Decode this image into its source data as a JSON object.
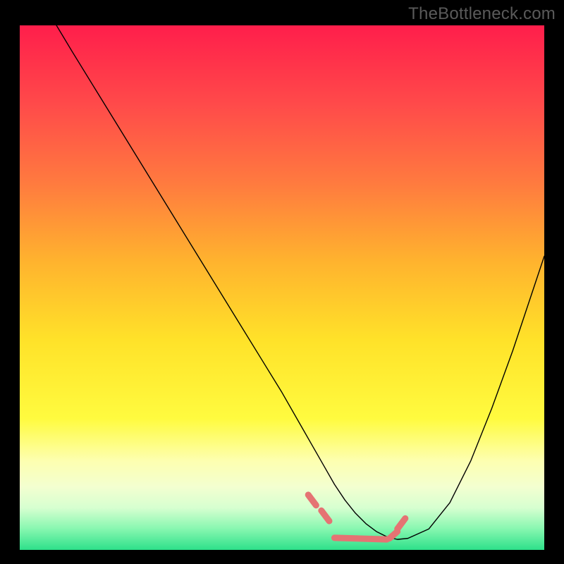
{
  "watermark": "TheBottleneck.com",
  "chart_data": {
    "type": "line",
    "title": "",
    "xlabel": "",
    "ylabel": "",
    "xlim": [
      0,
      100
    ],
    "ylim": [
      0,
      100
    ],
    "grid": false,
    "legend": false,
    "background_gradient": {
      "stops": [
        {
          "offset": 0.0,
          "color": "#ff1e4b"
        },
        {
          "offset": 0.15,
          "color": "#ff4a4a"
        },
        {
          "offset": 0.3,
          "color": "#ff7a3f"
        },
        {
          "offset": 0.45,
          "color": "#ffb32e"
        },
        {
          "offset": 0.6,
          "color": "#ffe229"
        },
        {
          "offset": 0.75,
          "color": "#fffb3f"
        },
        {
          "offset": 0.83,
          "color": "#fdffb0"
        },
        {
          "offset": 0.88,
          "color": "#f3ffd0"
        },
        {
          "offset": 0.92,
          "color": "#d6ffd0"
        },
        {
          "offset": 0.96,
          "color": "#87f7b0"
        },
        {
          "offset": 1.0,
          "color": "#2de08a"
        }
      ]
    },
    "series": [
      {
        "name": "bottleneck-curve",
        "color": "#000000",
        "width": 1.4,
        "x": [
          7,
          10,
          14,
          18,
          22,
          26,
          30,
          34,
          38,
          42,
          46,
          50,
          54,
          56,
          58,
          60,
          62,
          64,
          66,
          68,
          70,
          72,
          74,
          78,
          82,
          86,
          90,
          94,
          98,
          100
        ],
        "y": [
          100,
          95,
          88.5,
          82,
          75.5,
          69,
          62.5,
          56,
          49.5,
          43,
          36.5,
          30,
          23,
          19.5,
          16,
          12.5,
          9.5,
          7,
          5,
          3.5,
          2.5,
          2,
          2.2,
          4,
          9,
          17,
          27,
          38,
          50,
          56
        ]
      },
      {
        "name": "flat-zone-marker",
        "color": "#e57373",
        "width": 9,
        "linecap": "round",
        "segments": [
          {
            "x": [
              55,
              56.5
            ],
            "y": [
              10.5,
              8.5
            ]
          },
          {
            "x": [
              57.5,
              59
            ],
            "y": [
              7.5,
              5.5
            ]
          },
          {
            "x": [
              60,
              70
            ],
            "y": [
              2.3,
              2.0
            ]
          },
          {
            "x": [
              70.5,
              72
            ],
            "y": [
              2.2,
              3.5
            ]
          },
          {
            "x": [
              72,
              73.5
            ],
            "y": [
              4,
              6
            ]
          }
        ]
      }
    ]
  }
}
